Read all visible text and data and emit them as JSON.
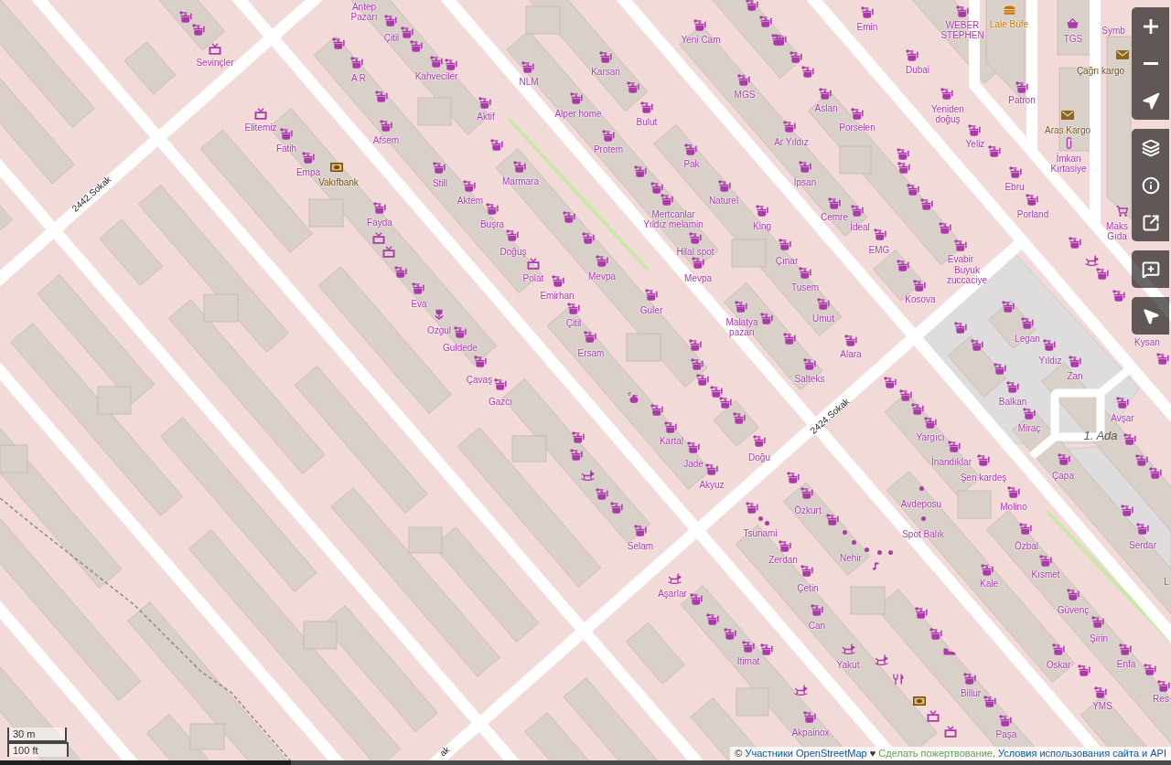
{
  "map": {
    "streets": [
      "2442.Sokak",
      "2424.Sokak",
      "ak"
    ],
    "places": [
      "1. Ada"
    ],
    "shops": [
      "Antep Pazarı",
      "Emin",
      "Çitil",
      "Yeni Cam",
      "WEBER STEPHEN",
      "Symb",
      "TGS",
      "Sevinçler",
      "A R",
      "Kahveciler",
      "Karsan",
      "Dubai",
      "NLM",
      "MGS",
      "Patron",
      "Aslan",
      "Aktif",
      "Alper home",
      "Bulut",
      "Yeniden doğuş",
      "Elitemiz",
      "Porselen",
      "Afsem",
      "Fatih",
      "Protem",
      "Ar Yıldız",
      "Yeliz",
      "Pak",
      "Empa",
      "İmkan Kırtasiye",
      "Still",
      "Marmara",
      "İpsan",
      "Ebru",
      "Aktem",
      "Naturel",
      "Fayda",
      "Buşra",
      "Mertcanlar Yıldız melamin",
      "Cemre",
      "Porland",
      "King",
      "İdeal",
      "Maks Gıda",
      "Doğuş",
      "Hilal spot",
      "EMG",
      "Çınar",
      "Evabir",
      "Polat",
      "Mevpa",
      "Mevpa",
      "Buyuk zuccaciye",
      "Tusem",
      "Emirhan",
      "Eva",
      "Kosova",
      "Guler",
      "Çitil",
      "Ozgul",
      "Malatya pazarı",
      "Umut",
      "Legan",
      "Kysan",
      "Guldede",
      "Ersam",
      "Alara",
      "Yıldız",
      "Çavaş",
      "Salteks",
      "Zan",
      "Gazcı",
      "Balkan",
      "Avşar",
      "Miraç",
      "Kartal",
      "Yargıcı",
      "Jade",
      "Doğu",
      "İnandıklar",
      "Şen kardeş",
      "Çapa",
      "Akyuz",
      "Özkurt",
      "Avdeposu",
      "Molino",
      "Tsunami",
      "Spot Balık",
      "Selam",
      "Özbal",
      "Serdar",
      "Zerdan",
      "Nehir",
      "Kısmet",
      "Aşarlar",
      "Çetin",
      "Kale",
      "L",
      "Güvenç",
      "Can",
      "Şirin",
      "Itimat",
      "Yakut",
      "Oskar",
      "Enfa",
      "Billur",
      "Res",
      "YMS",
      "Akpainox",
      "Paşa"
    ],
    "amenities": [
      "Lale Büfe",
      "Çağrı kargo",
      "Aras Kargo",
      "Vakıfbank"
    ]
  },
  "scale_bar": {
    "metric": "30 m",
    "imperial": "100 ft"
  },
  "attribution": {
    "prefix": "©",
    "contributors_link": "Участники OpenStreetMap",
    "separator": "♥",
    "donate_link": "Сделать пожертвование",
    "suffix": ".",
    "terms_link": "Условия использования сайта и API"
  }
}
